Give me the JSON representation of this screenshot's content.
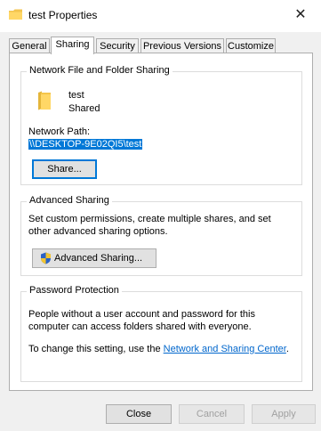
{
  "window": {
    "title": "test Properties",
    "close_glyph": "✕"
  },
  "tabs": [
    {
      "label": "General"
    },
    {
      "label": "Sharing"
    },
    {
      "label": "Security"
    },
    {
      "label": "Previous Versions"
    },
    {
      "label": "Customize"
    }
  ],
  "network_sharing": {
    "title": "Network File and Folder Sharing",
    "folder_name": "test",
    "status": "Shared",
    "path_label": "Network Path:",
    "path_value": "\\\\DESKTOP-9E02QI5\\test",
    "share_button": "Share..."
  },
  "advanced_sharing": {
    "title": "Advanced Sharing",
    "description": "Set custom permissions, create multiple shares, and set other advanced sharing options.",
    "button": "Advanced Sharing..."
  },
  "password_protection": {
    "title": "Password Protection",
    "description": "People without a user account and password for this computer can access folders shared with everyone.",
    "change_text_prefix": "To change this setting, use the ",
    "link_text": "Network and Sharing Center",
    "change_text_suffix": "."
  },
  "footer": {
    "close": "Close",
    "cancel": "Cancel",
    "apply": "Apply"
  },
  "icons": {
    "title": "folder-icon",
    "folder": "folder-icon",
    "shield": "uac-shield-icon"
  }
}
